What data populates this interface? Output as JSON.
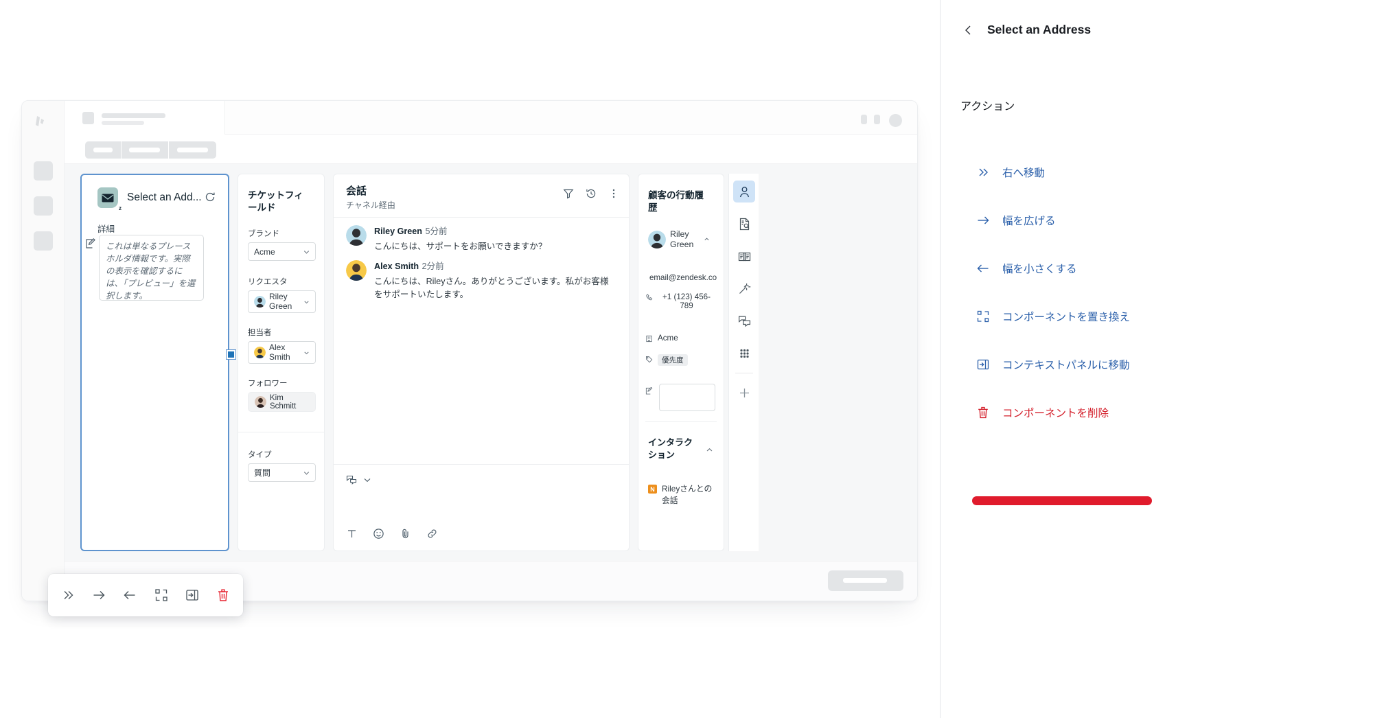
{
  "side_panel": {
    "back_icon": "chevron-left-icon",
    "title": "Select an Address",
    "section_title": "アクション",
    "actions": [
      {
        "icon": "chevrons-right-icon",
        "label": "右へ移動",
        "tone": "link"
      },
      {
        "icon": "arrow-right-icon",
        "label": "幅を広げる",
        "tone": "link"
      },
      {
        "icon": "arrow-left-icon",
        "label": "幅を小さくする",
        "tone": "link"
      },
      {
        "icon": "swap-component-icon",
        "label": "コンポーネントを置き換え",
        "tone": "link"
      },
      {
        "icon": "move-to-panel-icon",
        "label": "コンテキストパネルに移動",
        "tone": "link"
      },
      {
        "icon": "trash-icon",
        "label": "コンポーネントを削除",
        "tone": "danger"
      }
    ],
    "highlight_color": "#e01b2c",
    "link_color": "#2a5faa",
    "danger_color": "#d4202c"
  },
  "mock": {
    "app_card": {
      "icon": "email-app-icon",
      "badge": "z",
      "title": "Select an Add...",
      "refresh_icon": "refresh-icon",
      "field_label": "詳細",
      "edit_icon": "edit-box-icon",
      "textarea_placeholder": "これは単なるプレースホルダ情報です。実際の表示を確認するには、「プレビュー」を選択します。"
    },
    "ticket_fields": {
      "title": "チケットフィールド",
      "brand": {
        "label": "ブランド",
        "value": "Acme",
        "chevron": "chevron-down-icon"
      },
      "requester": {
        "label": "リクエスタ",
        "value": "Riley Green",
        "chevron": "chevron-down-icon"
      },
      "assignee": {
        "label": "担当者",
        "value": "Alex Smith",
        "chevron": "chevron-down-icon"
      },
      "follower": {
        "label": "フォロワー",
        "value": "Kim Schmitt"
      },
      "type": {
        "label": "タイプ",
        "value": "質問",
        "chevron": "chevron-down-icon"
      }
    },
    "conversation": {
      "title": "会話",
      "subtitle": "チャネル経由",
      "actions": [
        "filter-icon",
        "history-icon",
        "more-vertical-icon"
      ],
      "messages": [
        {
          "author": "Riley Green",
          "time": "5分前",
          "text": "こんにちは、サポートをお願いできますか？"
        },
        {
          "author": "Alex Smith",
          "time": "2分前",
          "text": "こんにちは、Rileyさん。ありがとうございます。私がお客様をサポートいたします。"
        }
      ],
      "compose": {
        "channel_icon": "reply-channel-icon",
        "channel_chevron": "chevron-down-icon",
        "format_icons": [
          "text-format-icon",
          "emoji-icon",
          "attachment-icon",
          "link-icon"
        ]
      }
    },
    "customer": {
      "title": "顧客の行動履歴",
      "name": "Riley Green",
      "collapse_icon": "chevron-up-icon",
      "email": "email@zendesk.co",
      "phone": "+1 (123) 456-789",
      "org": "Acme",
      "tag": "優先度",
      "note_icon": "note-edit-icon",
      "interactions_title": "インタラクション",
      "interactions_caret": "chevron-up-icon",
      "interactions": [
        {
          "badge": "N",
          "text": "Rileyさんとの会話"
        }
      ]
    },
    "rail_icons": [
      "user-icon",
      "document-search-icon",
      "knowledge-book-icon",
      "magic-wand-icon",
      "conversations-icon",
      "apps-grid-icon",
      "plus-icon"
    ],
    "float_toolbar": [
      {
        "icon": "chevrons-right-icon",
        "name": "move-right-button",
        "tone": "normal"
      },
      {
        "icon": "arrow-right-icon",
        "name": "widen-button",
        "tone": "normal"
      },
      {
        "icon": "arrow-left-icon",
        "name": "narrow-button",
        "tone": "normal"
      },
      {
        "icon": "swap-component-icon",
        "name": "replace-component-button",
        "tone": "normal"
      },
      {
        "icon": "move-to-panel-icon",
        "name": "move-to-context-panel-button",
        "tone": "normal"
      },
      {
        "icon": "trash-icon",
        "name": "delete-component-button",
        "tone": "danger"
      }
    ]
  }
}
